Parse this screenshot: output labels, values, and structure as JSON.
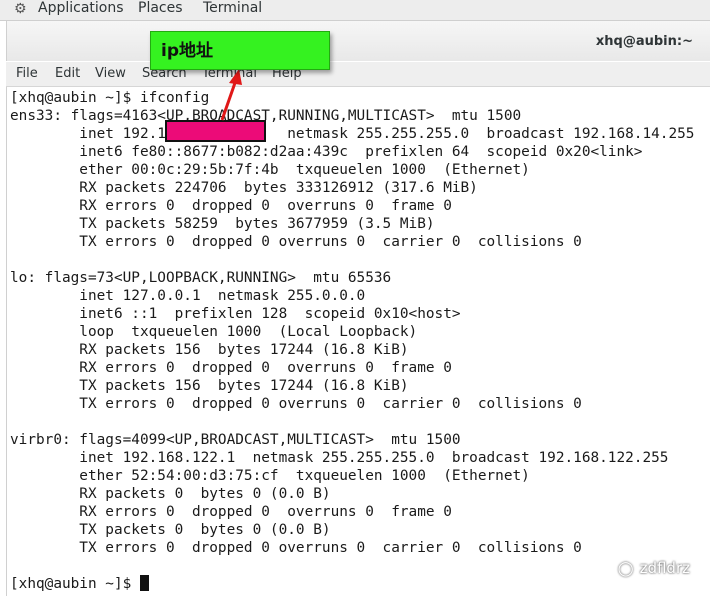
{
  "topbar": {
    "menus": [
      "Applications",
      "Places",
      "Terminal"
    ]
  },
  "window": {
    "title": "xhq@aubin:~"
  },
  "menubar": {
    "items": [
      "File",
      "Edit",
      "View",
      "Search",
      "Terminal",
      "Help"
    ]
  },
  "terminal": {
    "lines": [
      "[xhq@aubin ~]$ ifconfig",
      "ens33: flags=4163<UP,BROADCAST,RUNNING,MULTICAST>  mtu 1500",
      "        inet 192.1              netmask 255.255.255.0  broadcast 192.168.14.255",
      "        inet6 fe80::8677:b082:d2aa:439c  prefixlen 64  scopeid 0x20<link>",
      "        ether 00:0c:29:5b:7f:4b  txqueuelen 1000  (Ethernet)",
      "        RX packets 224706  bytes 333126912 (317.6 MiB)",
      "        RX errors 0  dropped 0  overruns 0  frame 0",
      "        TX packets 58259  bytes 3677959 (3.5 MiB)",
      "        TX errors 0  dropped 0 overruns 0  carrier 0  collisions 0",
      "",
      "lo: flags=73<UP,LOOPBACK,RUNNING>  mtu 65536",
      "        inet 127.0.0.1  netmask 255.0.0.0",
      "        inet6 ::1  prefixlen 128  scopeid 0x10<host>",
      "        loop  txqueuelen 1000  (Local Loopback)",
      "        RX packets 156  bytes 17244 (16.8 KiB)",
      "        RX errors 0  dropped 0  overruns 0  frame 0",
      "        TX packets 156  bytes 17244 (16.8 KiB)",
      "        TX errors 0  dropped 0 overruns 0  carrier 0  collisions 0",
      "",
      "virbr0: flags=4099<UP,BROADCAST,MULTICAST>  mtu 1500",
      "        inet 192.168.122.1  netmask 255.255.255.0  broadcast 192.168.122.255",
      "        ether 52:54:00:d3:75:cf  txqueuelen 1000  (Ethernet)",
      "        RX packets 0  bytes 0 (0.0 B)",
      "        RX errors 0  dropped 0  overruns 0  frame 0",
      "        TX packets 0  bytes 0 (0.0 B)",
      "        TX errors 0  dropped 0 overruns 0  carrier 0  collisions 0",
      "",
      "[xhq@aubin ~]$ "
    ]
  },
  "annotation": {
    "label": "ip地址",
    "fill_color": "#35f220",
    "redaction_color": "#ec0b78",
    "arrow_color": "#e01818"
  },
  "watermark": {
    "text": "zdfldrz",
    "icon": "wechat-icon"
  },
  "icons": {
    "apps": "apps-menu-icon"
  }
}
